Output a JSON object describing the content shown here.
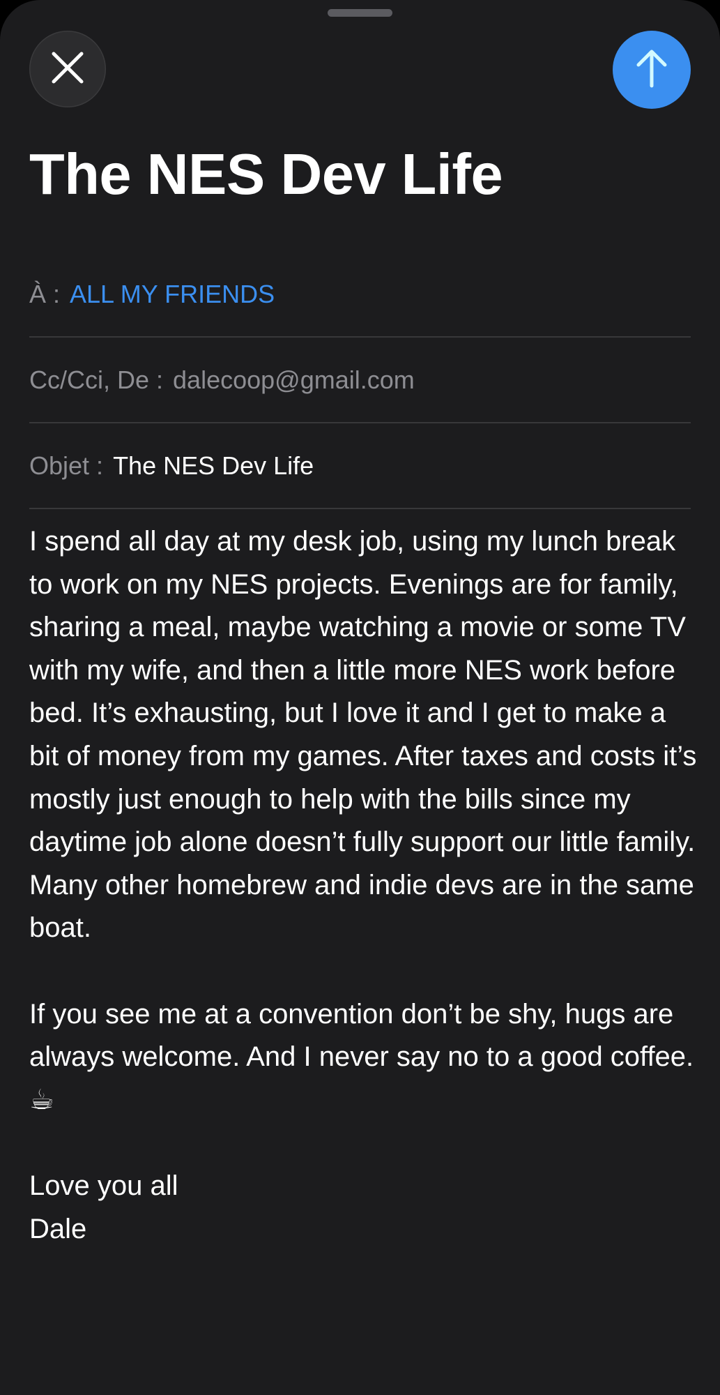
{
  "compose": {
    "title": "The NES Dev Life",
    "to_label": "À :",
    "to_value": "ALL MY FRIENDS",
    "cc_label": "Cc/Cci, De :",
    "cc_value": "dalecoop@gmail.com",
    "subject_label": "Objet :",
    "subject_value": "The NES Dev Life",
    "body": {
      "paragraph_1": "I spend all day at my desk job, using my lunch break to work on my NES projects. Evenings are for family, sharing a meal, maybe watching a movie or some TV with my wife, and then a little more NES work before bed. It’s exhausting, but I love it and I get to make a bit of money from my games. After taxes and costs it’s mostly just enough to help with the bills since my daytime job alone doesn’t fully support our little family. Many other homebrew and indie devs are in the same boat.",
      "paragraph_2": "If you see me at a convention don’t be shy, hugs are always welcome. And I never say no to a good coffee. ☕",
      "closing": "Love you all",
      "signature": "Dale"
    }
  },
  "icons": {
    "close": "close-icon",
    "send": "arrow-up-icon"
  },
  "colors": {
    "background": "#1c1c1e",
    "accent": "#3b8ff0",
    "secondary_text": "#8e8e93"
  }
}
